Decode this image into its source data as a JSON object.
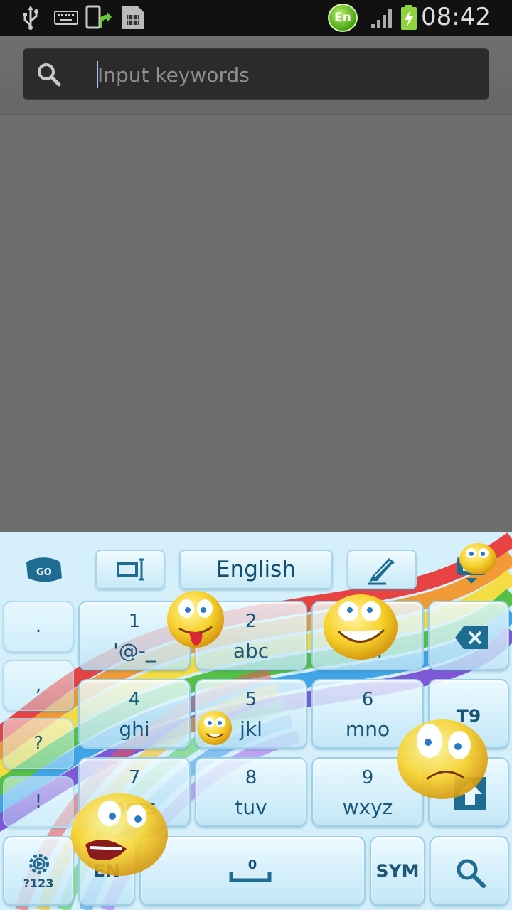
{
  "status_bar": {
    "time": "08:42",
    "language_badge": "En",
    "icons": [
      "usb-icon",
      "keyboard-icon",
      "upload-icon",
      "sim-card-icon",
      "language-badge-icon",
      "signal-icon",
      "battery-charging-icon"
    ]
  },
  "search": {
    "placeholder": "Input keywords",
    "icon": "search-icon"
  },
  "keyboard": {
    "toolbar": {
      "go_logo": "GO",
      "language": "English"
    },
    "side_keys": [
      ".",
      ",",
      "?",
      "!"
    ],
    "keys": [
      {
        "num": "1",
        "letters": "'@-_"
      },
      {
        "num": "2",
        "letters": "abc"
      },
      {
        "num": "3",
        "letters": "def"
      },
      {
        "num": "4",
        "letters": "ghi"
      },
      {
        "num": "5",
        "letters": "jkl"
      },
      {
        "num": "6",
        "letters": "mno"
      },
      {
        "num": "7",
        "letters": "pqrs"
      },
      {
        "num": "8",
        "letters": "tuv"
      },
      {
        "num": "9",
        "letters": "wxyz"
      }
    ],
    "t9_label": "T9",
    "settings_label": "?123",
    "lang_key": "EN",
    "space_num": "0",
    "sym_key": "SYM"
  },
  "colors": {
    "keyboard_bg": "#d5f0fb",
    "key_text": "#1a5677",
    "statusbar_bg": "#111111",
    "screen_bg": "#6e6e6e"
  }
}
